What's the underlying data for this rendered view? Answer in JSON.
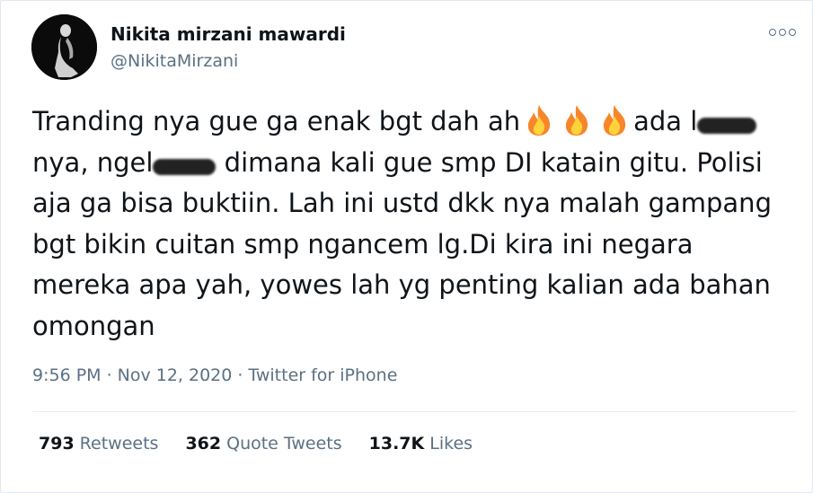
{
  "user": {
    "display_name": "Nikita mirzani mawardi",
    "handle": "@NikitaMirzani",
    "avatar_icon": "profile-photo"
  },
  "more_icon": "more-options-icon",
  "tweet": {
    "line1_text": "Tranding nya gue ga enak bgt dah ah",
    "line1_after": "ada l",
    "line2_before": "nya, ngel",
    "line2_after": " dimana kali gue smp DI katain gitu. Polisi",
    "line3": "aja ga bisa buktiin. Lah ini ustd dkk nya malah gampang",
    "line4": "bgt bikin cuitan smp ngancem lg.Di kira ini negara",
    "line5": "mereka apa yah, yowes lah yg penting kalian ada bahan",
    "line6": "omongan",
    "emoji": "fire-emoji"
  },
  "meta": {
    "time": "9:56 PM",
    "date": "Nov 12, 2020",
    "source": "Twitter for iPhone",
    "separator": "·"
  },
  "stats": {
    "retweets_count": "793",
    "retweets_label": "Retweets",
    "quotes_count": "362",
    "quotes_label": "Quote Tweets",
    "likes_count": "13.7K",
    "likes_label": "Likes"
  },
  "colors": {
    "text": "#0f1419",
    "secondary": "#5b7083",
    "divider": "#e6ecf0"
  }
}
